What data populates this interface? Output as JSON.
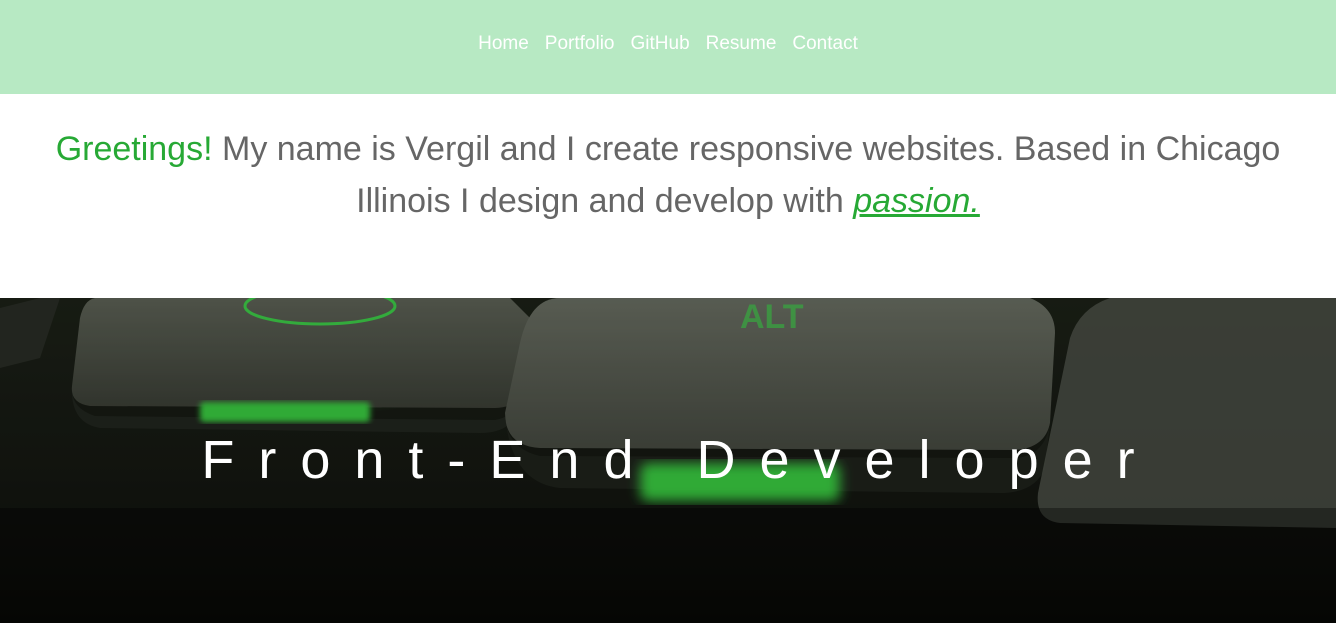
{
  "nav": {
    "items": [
      {
        "label": "Home"
      },
      {
        "label": "Portfolio"
      },
      {
        "label": "GitHub"
      },
      {
        "label": "Resume"
      },
      {
        "label": "Contact"
      }
    ]
  },
  "intro": {
    "greeting": "Greetings!",
    "text": " My name is Vergil and I create responsive websites. Based in Chicago Illinois I design and develop with ",
    "passion": "passion."
  },
  "hero": {
    "title": "Front-End Developer"
  },
  "colors": {
    "nav_bg": "#b7e9c3",
    "accent": "#27a935",
    "body_text": "#666666"
  }
}
